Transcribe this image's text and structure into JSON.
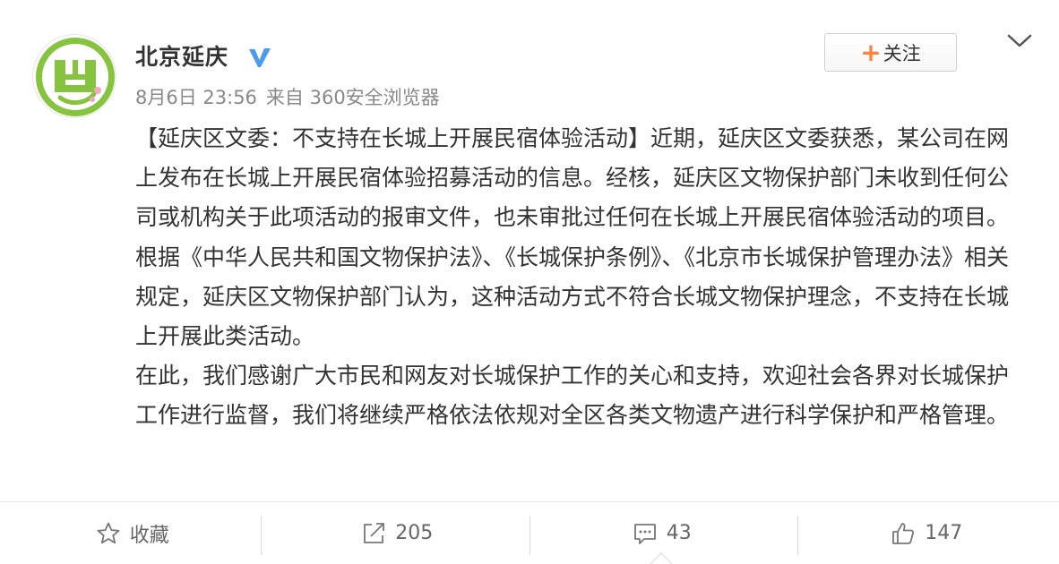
{
  "post": {
    "author": "北京延庆",
    "date": "8月6日 23:56",
    "source": "来自 360安全浏览器",
    "follow_label": "关注",
    "follow_plus": "+",
    "paragraphs": [
      "【延庆区文委：不支持在长城上开展民宿体验活动】近期，延庆区文委获悉，某公司在网上发布在长城上开展民宿体验招募活动的信息。经核，延庆区文物保护部门未收到任何公司或机构关于此项活动的报审文件，也未审批过任何在长城上开展民宿体验活动的项目。根据《中华人民共和国文物保护法》、《长城保护条例》、《北京市长城保护管理办法》相关规定，延庆区文物保护部门认为，这种活动方式不符合长城文物保护理念，不支持在长城上开展此类活动。",
      "在此，我们感谢广大市民和网友对长城保护工作的关心和支持，欢迎社会各界对长城保护工作进行监督，我们将继续严格依法依规对全区各类文物遗产进行科学保护和严格管理。"
    ]
  },
  "actions": {
    "favorite_label": "收藏",
    "repost_count": "205",
    "comment_count": "43",
    "like_count": "147"
  },
  "icons": {
    "verified": "verified-v-icon",
    "follow": "plus-icon",
    "menu": "chevron-down-icon",
    "favorite": "star-icon",
    "repost": "share-arrow-icon",
    "comment": "comment-icon",
    "like": "thumbs-up-icon"
  },
  "colors": {
    "accent_orange": "#ff8140",
    "verified_blue": "#4b9cf0",
    "avatar_green": "#86c440"
  }
}
